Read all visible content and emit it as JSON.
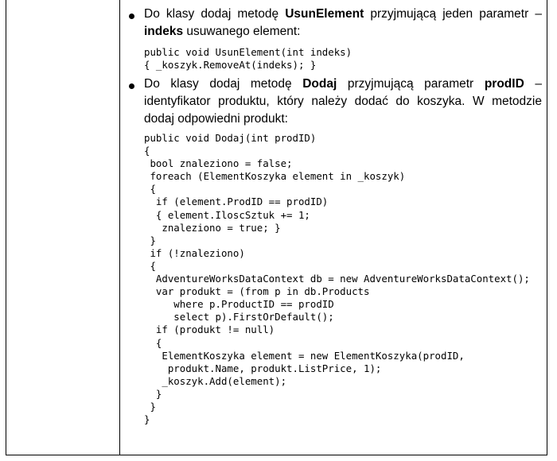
{
  "bullet1": {
    "pre": "Do klasy dodaj metodę ",
    "method": "UsunElement",
    "mid": " przyjmującą jeden parametr – ",
    "param": "indeks",
    "post": " usuwanego element:"
  },
  "code1": [
    "public void UsunElement(int indeks)",
    "{ _koszyk.RemoveAt(indeks); }"
  ],
  "bullet2": {
    "pre": "Do klasy dodaj metodę ",
    "method": "Dodaj",
    "mid": " przyjmującą parametr ",
    "param": "prodID",
    "post": " – identyfikator produktu, który należy dodać do koszyka. W metodzie dodaj odpowiedni produkt:"
  },
  "code2": [
    "public void Dodaj(int prodID)",
    "{",
    " bool znaleziono = false;",
    " foreach (ElementKoszyka element in _koszyk)",
    " {",
    "  if (element.ProdID == prodID)",
    "  { element.IloscSztuk += 1;",
    "   znaleziono = true; }",
    " }",
    " if (!znaleziono)",
    " {",
    "  AdventureWorksDataContext db = new AdventureWorksDataContext();",
    "  var produkt = (from p in db.Products",
    "     where p.ProductID == prodID",
    "     select p).FirstOrDefault();",
    "  if (produkt != null)",
    "  {",
    "   ElementKoszyka element = new ElementKoszyka(prodID,",
    "    produkt.Name, produkt.ListPrice, 1);",
    "   _koszyk.Add(element);",
    "  }",
    " }",
    "}"
  ]
}
